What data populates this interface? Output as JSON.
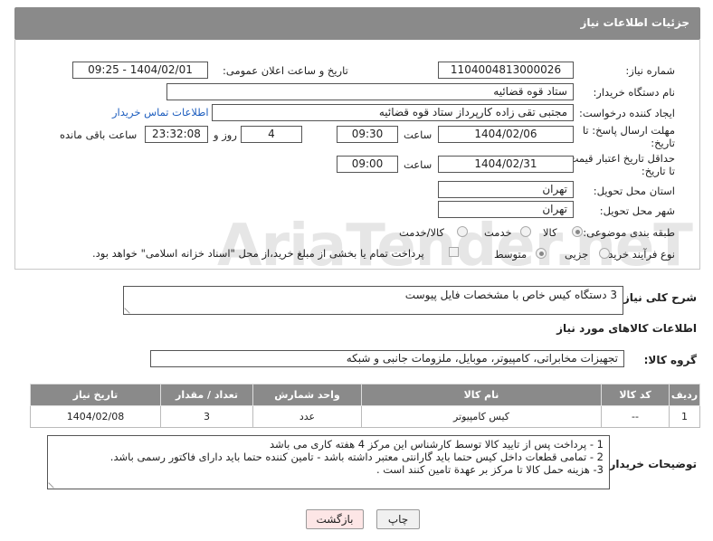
{
  "header": {
    "title": "جزئیات اطلاعات نیاز"
  },
  "fields": {
    "need_number_label": "شماره نیاز:",
    "need_number": "1104004813000026",
    "announce_label": "تاریخ و ساعت اعلان عمومی:",
    "announce_value": "1404/02/01 - 09:25",
    "buyer_label": "نام دستگاه خریدار:",
    "buyer_value": "ستاد قوه قضائیه",
    "creator_label": "ایجاد کننده درخواست:",
    "creator_value": "مجتبی تقی زاده کارپرداز ستاد قوه قضائیه",
    "contact_link": "اطلاعات تماس خریدار",
    "deadline_label_1": "مهلت ارسال پاسخ: تا",
    "deadline_label_2": "تاریخ:",
    "deadline_date": "1404/02/06",
    "time_label": "ساعت",
    "deadline_time": "09:30",
    "days_value": "4",
    "days_label": "روز و",
    "remaining_time": "23:32:08",
    "remaining_label": "ساعت باقی مانده",
    "validity_label_1": "حداقل تاریخ اعتبار قیمت:",
    "validity_label_2": "تا تاریخ:",
    "validity_date": "1404/02/31",
    "validity_time": "09:00",
    "province_label": "استان محل تحویل:",
    "province_value": "تهران",
    "city_label": "شهر محل تحویل:",
    "city_value": "تهران",
    "category_label": "طبقه بندی موضوعی:",
    "category_options": [
      "کالا",
      "خدمت",
      "کالا/خدمت"
    ],
    "process_label": "نوع فرآیند خرید :",
    "process_options": [
      "جزیی",
      "متوسط"
    ],
    "payment_note": "پرداخت تمام یا بخشی از مبلغ خرید،از محل \"اسناد خزانه اسلامی\" خواهد بود."
  },
  "summary": {
    "label": "شرح کلی نیاز:",
    "value": "3 دستگاه کیس خاص با مشخصات فایل پیوست"
  },
  "goods_info_title": "اطلاعات کالاهای مورد نیاز",
  "goods_group": {
    "label": "گروه کالا:",
    "value": "تجهیزات مخابراتی، کامپیوتر، موبایل، ملزومات جانبی و شبکه"
  },
  "table": {
    "headers": [
      "ردیف",
      "کد کالا",
      "نام کالا",
      "واحد شمارش",
      "تعداد / مقدار",
      "تاریخ نیاز"
    ],
    "rows": [
      [
        "1",
        "--",
        "کیس کامپیوتر",
        "عدد",
        "3",
        "1404/02/08"
      ]
    ]
  },
  "buyer_notes": {
    "label": "توضیحات خریدار:",
    "lines": [
      "1  - پرداخت پس از تایید کالا توسط کارشناس این مرکز 4 هفته کاری می باشد",
      "2 - تمامی قطعات داخل کیس حتما باید گارانتی معتبر داشته باشد - تامین کننده حتما باید دارای فاکتور رسمی باشد.",
      "3- هزینه حمل کالا تا مرکز بر عهدة تامین کنند است ."
    ]
  },
  "buttons": {
    "print": "چاپ",
    "back": "بازگشت"
  },
  "watermark": "AriaTender.neT"
}
